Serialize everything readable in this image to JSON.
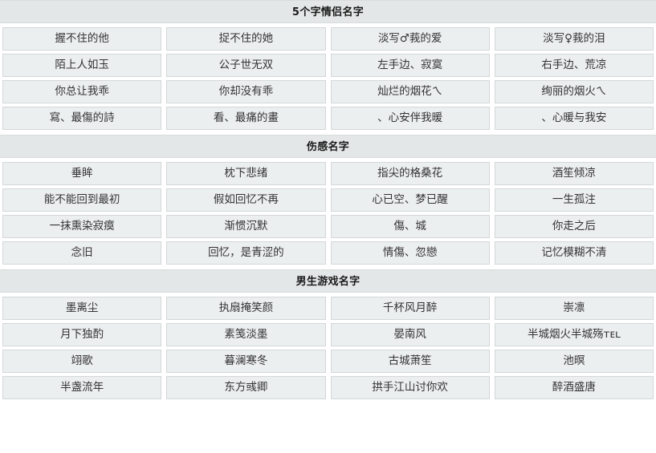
{
  "sections": [
    {
      "title": "5个字情侣名字",
      "rows": [
        [
          "握不住的他",
          "捉不住的她",
          "淡写♂莪的爱",
          "淡写♀莪的泪"
        ],
        [
          "陌上人如玉",
          "公子世无双",
          "左手边、寂寞",
          "右手边、荒凉"
        ],
        [
          "你总让我乖",
          "你却没有乖",
          "灿烂的烟花ㄟ",
          "绚丽的烟火ㄟ"
        ],
        [
          "寫、最傷的詩",
          "看、最痛的畫",
          "、心安伴我暖",
          "、心暖与我安"
        ]
      ]
    },
    {
      "title": "伤感名字",
      "rows": [
        [
          "垂眸",
          "枕下悲绪",
          "指尖的格桑花",
          "酒笙倾凉"
        ],
        [
          "能不能回到最初",
          "假如回忆不再",
          "心已空、梦已醒",
          "一生孤注"
        ],
        [
          "一抹熏染寂瘼",
          "渐惯沉默",
          "傷、城",
          "你走之后"
        ],
        [
          "念旧",
          "回忆，是青涩的",
          "情傷、忽戀",
          "记忆模糊不清"
        ]
      ]
    },
    {
      "title": "男生游戏名字",
      "rows": [
        [
          "墨离尘",
          "执扇掩笑颜",
          "千杯风月醉",
          "崇凛"
        ],
        [
          "月下独酌",
          "素笺淡墨",
          "晏南风",
          "半城烟火半城殇ᴛᴇʟ"
        ],
        [
          "翊歌",
          "暮澜寒冬",
          "古城萧笙",
          "池暝"
        ],
        [
          "半盏流年",
          "东方彧卿",
          "拱手江山讨你欢",
          "醉酒盛唐"
        ]
      ]
    }
  ]
}
